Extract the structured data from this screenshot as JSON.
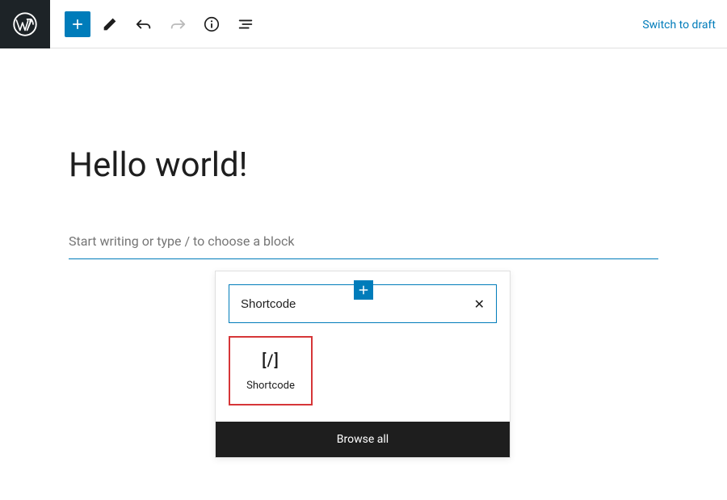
{
  "toolbar": {
    "switch_to_draft_label": "Switch to draft"
  },
  "editor": {
    "title": "Hello world!",
    "block_placeholder": "Start writing or type / to choose a block"
  },
  "inserter": {
    "search_value": "Shortcode",
    "results": [
      {
        "icon": "[/]",
        "label": "Shortcode"
      }
    ],
    "browse_all_label": "Browse all"
  }
}
